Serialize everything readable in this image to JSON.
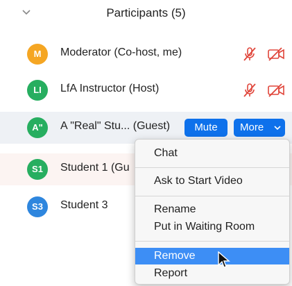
{
  "header": {
    "title": "Participants (5)"
  },
  "participants": [
    {
      "initials": "M",
      "name": "Moderator (Co-host, me)",
      "avatar_color": "#f5a623"
    },
    {
      "initials": "LI",
      "name": "LfA Instructor (Host)",
      "avatar_color": "#27ae60"
    },
    {
      "initials": "A\"",
      "name": "A \"Real\" Stu... (Guest)",
      "avatar_color": "#27ae60"
    },
    {
      "initials": "S1",
      "name": "Student 1 (Gu",
      "avatar_color": "#27ae60"
    },
    {
      "initials": "S3",
      "name": "Student 3",
      "avatar_color": "#2e86de"
    }
  ],
  "row_actions": {
    "mute_label": "Mute",
    "more_label": "More"
  },
  "menu": {
    "items": [
      "Chat",
      "Ask to Start Video",
      "Rename",
      "Put in Waiting Room",
      "Remove",
      "Report"
    ],
    "selected": "Remove"
  },
  "colors": {
    "accent": "#0e71eb",
    "muted_icon": "#e0453a",
    "menu_highlight": "#3d8ef5"
  }
}
